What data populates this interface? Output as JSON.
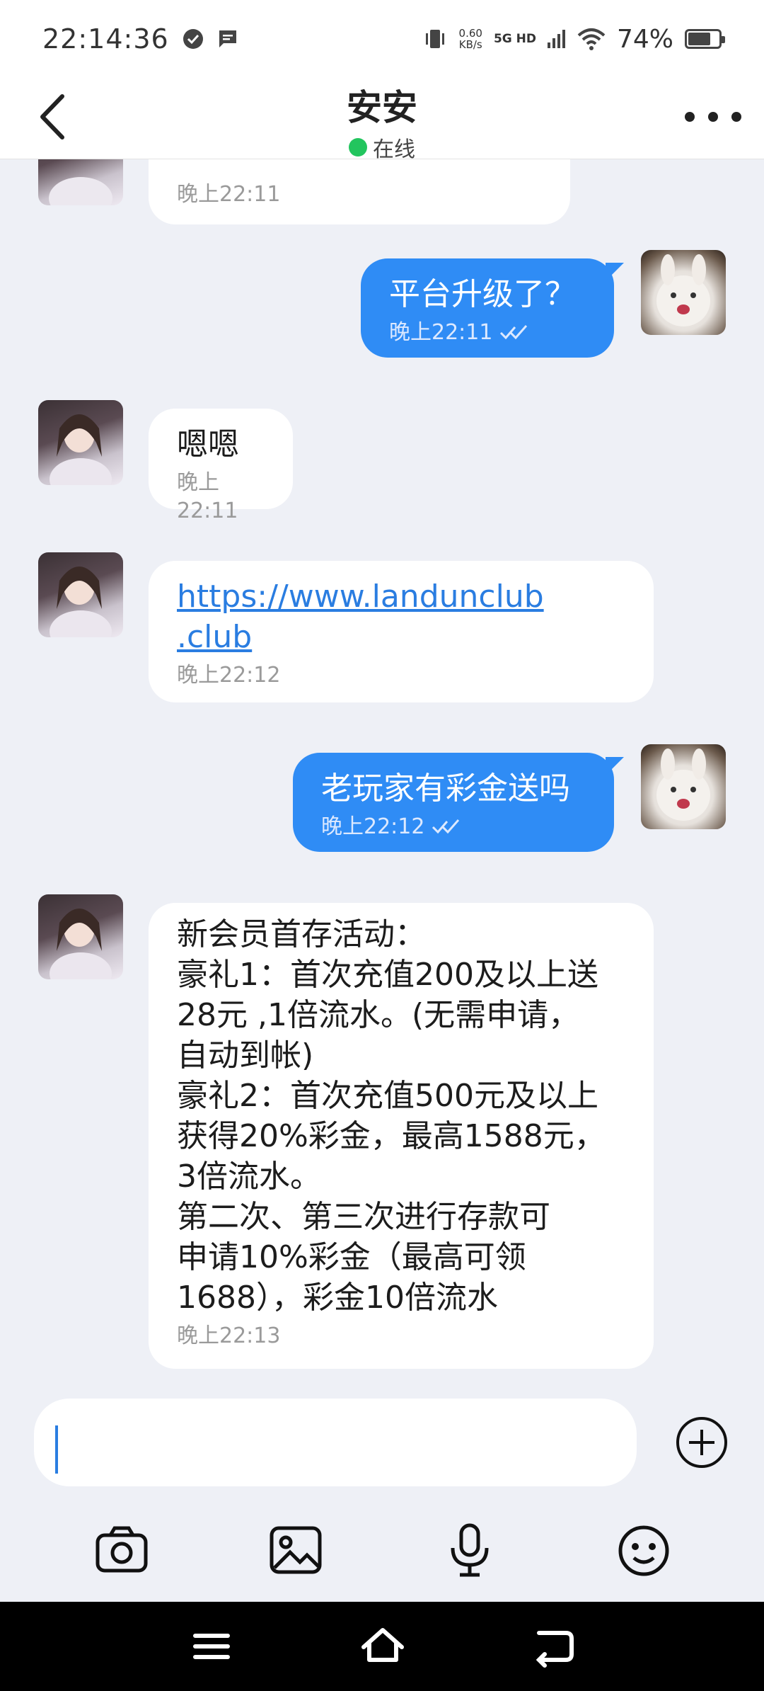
{
  "status_bar": {
    "time": "22:14:36",
    "net_speed_value": "0.60",
    "net_speed_unit": "KB/s",
    "network_label": "5G HD",
    "battery_percent": "74%",
    "battery_level": 0.74
  },
  "header": {
    "title": "安安",
    "status": "在线"
  },
  "messages": [
    {
      "direction": "in",
      "text": "",
      "time": "晚上22:11"
    },
    {
      "direction": "out",
      "text": "平台升级了？",
      "time": "晚上22:11"
    },
    {
      "direction": "in",
      "text": "嗯嗯",
      "time": "晚上22:11"
    },
    {
      "direction": "in",
      "link_line1": "https://www.landunclub",
      "link_line2": ".club",
      "time": "晚上22:12"
    },
    {
      "direction": "out",
      "text": "老玩家有彩金送吗",
      "time": "晚上22:12"
    },
    {
      "direction": "in",
      "lines": [
        "新会员首存活动：",
        "豪礼1：首次充值200及以上送",
        "28元 ,1倍流水。(无需申请，",
        "自动到帐)",
        "豪礼2：首次充值500元及以上",
        "获得20%彩金，最高1588元，",
        "3倍流水。",
        "第二次、第三次进行存款可",
        "申请10%彩金（最高可领",
        "1688），彩金10倍流水"
      ],
      "time": "晚上22:13"
    }
  ],
  "composer": {
    "input_value": ""
  },
  "colors": {
    "accent": "#2f8cf5",
    "online": "#22c55e",
    "background": "#eef0f6",
    "link": "#2a7de1"
  },
  "icons": {
    "back": "chevron-left-icon",
    "more": "more-dots-icon",
    "plus": "plus-circle-icon",
    "camera": "camera-icon",
    "image": "image-icon",
    "mic": "microphone-icon",
    "emoji": "emoji-icon",
    "read": "double-check-icon"
  }
}
